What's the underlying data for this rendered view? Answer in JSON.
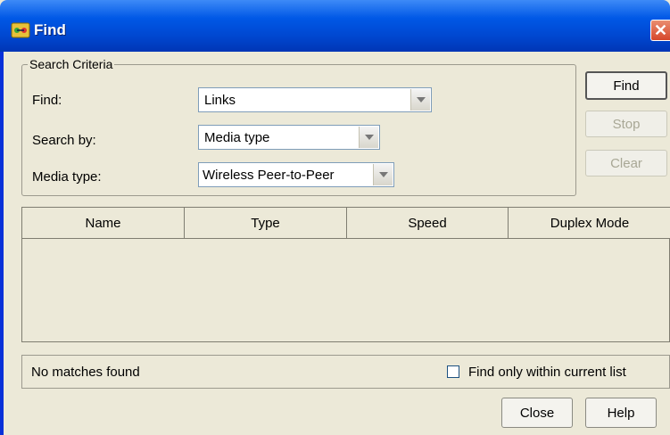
{
  "window": {
    "title": "Find",
    "close_glyph": "✕"
  },
  "criteria": {
    "legend": "Search Criteria",
    "find_label": "Find:",
    "find_value": "Links",
    "search_by_label": "Search by:",
    "search_by_value": "Media type",
    "media_type_label": "Media type:",
    "media_type_value": "Wireless Peer-to-Peer"
  },
  "buttons": {
    "find": "Find",
    "stop": "Stop",
    "clear": "Clear",
    "close": "Close",
    "help": "Help"
  },
  "table": {
    "columns": [
      "Name",
      "Type",
      "Speed",
      "Duplex Mode"
    ],
    "rows": []
  },
  "status": {
    "message": "No matches found",
    "only_current_list_label": "Find only within current list",
    "only_current_list_checked": false
  },
  "icons": {
    "app": "network-app-icon",
    "close": "close-icon",
    "dropdown": "chevron-down-icon"
  },
  "colors": {
    "titlebar": "#0058e6",
    "window_bg": "#ece9d8",
    "close_button": "#d6472b"
  }
}
